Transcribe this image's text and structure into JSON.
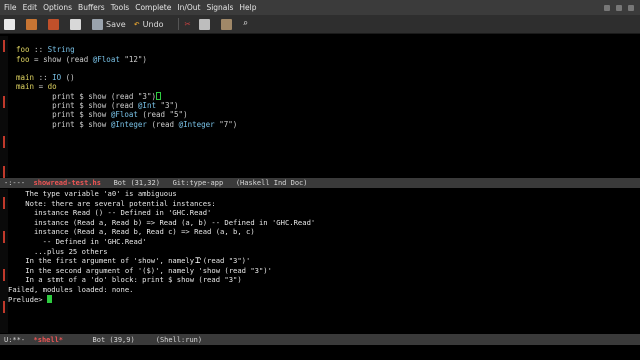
{
  "menubar": {
    "items": [
      "File",
      "Edit",
      "Options",
      "Buffers",
      "Tools",
      "Complete",
      "In/Out",
      "Signals",
      "Help"
    ]
  },
  "toolbar": {
    "save_label": "Save",
    "undo_label": "Undo"
  },
  "editor": {
    "lines": [
      {
        "segs": [
          {
            "t": "",
            "c": ""
          }
        ]
      },
      {
        "segs": [
          {
            "t": "foo",
            "c": "kw"
          },
          {
            "t": " :: ",
            "c": ""
          },
          {
            "t": "String",
            "c": "ty"
          }
        ]
      },
      {
        "segs": [
          {
            "t": "foo",
            "c": "kw"
          },
          {
            "t": " = show (read ",
            "c": ""
          },
          {
            "t": "@Float",
            "c": "ty"
          },
          {
            "t": " \"12\")",
            "c": ""
          }
        ]
      },
      {
        "segs": [
          {
            "t": "",
            "c": ""
          }
        ]
      },
      {
        "segs": [
          {
            "t": "main",
            "c": "kw"
          },
          {
            "t": " :: ",
            "c": ""
          },
          {
            "t": "IO",
            "c": "ty"
          },
          {
            "t": " ()",
            "c": ""
          }
        ]
      },
      {
        "segs": [
          {
            "t": "main",
            "c": "kw"
          },
          {
            "t": " = ",
            "c": ""
          },
          {
            "t": "do",
            "c": "kw"
          }
        ]
      },
      {
        "segs": [
          {
            "t": "        print $ show (read \"3\")",
            "c": ""
          }
        ],
        "cursor": true
      },
      {
        "segs": [
          {
            "t": "        print $ show (read ",
            "c": ""
          },
          {
            "t": "@Int",
            "c": "ty"
          },
          {
            "t": " \"3\")",
            "c": ""
          }
        ]
      },
      {
        "segs": [
          {
            "t": "        print $ show ",
            "c": ""
          },
          {
            "t": "@Float",
            "c": "ty"
          },
          {
            "t": " (read \"5\")",
            "c": ""
          }
        ]
      },
      {
        "segs": [
          {
            "t": "        print $ show ",
            "c": ""
          },
          {
            "t": "@Integer",
            "c": "ty"
          },
          {
            "t": " (read ",
            "c": ""
          },
          {
            "t": "@Integer",
            "c": "ty"
          },
          {
            "t": " \"7\")",
            "c": ""
          }
        ]
      }
    ]
  },
  "modeline_top": {
    "status": "-:---  ",
    "buffer_name": "showread-test.hs",
    "rest": "   Bot (31,32)   Git:type-app   (Haskell Ind Doc)"
  },
  "shell": {
    "lines": [
      "    The type variable 'a0' is ambiguous",
      "    Note: there are several potential instances:",
      "      instance Read () -- Defined in 'GHC.Read'",
      "      instance (Read a, Read b) => Read (a, b) -- Defined in 'GHC.Read'",
      "      instance (Read a, Read b, Read c) => Read (a, b, c)",
      "        -- Defined in 'GHC.Read'",
      "      ...plus 25 others",
      "    In the first argument of 'show', namely '(read \"3\")'",
      "    In the second argument of '($)', namely 'show (read \"3\")'",
      "    In a stmt of a 'do' block: print $ show (read \"3\")",
      "Failed, modules loaded: none."
    ],
    "prompt": "Prelude> "
  },
  "modeline_bottom": {
    "status": "U:**-  ",
    "buffer_name": "*shell*",
    "rest": "       Bot (39,9)     (Shell:run)"
  },
  "icons": [
    "new-file-icon",
    "open-folder-icon",
    "open-dir-icon",
    "close-icon",
    "save-icon",
    "undo-icon",
    "cut-icon",
    "copy-icon",
    "paste-icon",
    "search-icon"
  ],
  "colors": {
    "keyword": "#e0d562",
    "type": "#79c2e7",
    "buffer_name": "#ee5555",
    "cursor": "#2ecc40"
  }
}
